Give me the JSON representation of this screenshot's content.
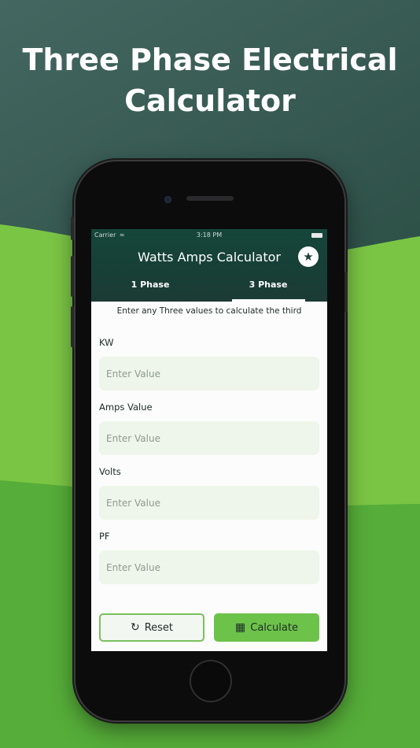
{
  "headline": {
    "line1": "Three Phase Electrical",
    "line2": "Calculator"
  },
  "status_bar": {
    "carrier": "Carrier",
    "wifi": "wifi-icon",
    "time": "3:18 PM",
    "battery": "battery-icon"
  },
  "app_bar": {
    "title": "Watts Amps Calculator",
    "favorite_icon": "star-icon"
  },
  "tabs": [
    {
      "label": "1 Phase",
      "selected": false
    },
    {
      "label": "3 Phase",
      "selected": true
    }
  ],
  "form": {
    "hint": "Enter any Three values to calculate the third",
    "fields": [
      {
        "label": "KW",
        "placeholder": "Enter Value",
        "value": ""
      },
      {
        "label": "Amps Value",
        "placeholder": "Enter Value",
        "value": ""
      },
      {
        "label": "Volts",
        "placeholder": "Enter Value",
        "value": ""
      },
      {
        "label": "PF",
        "placeholder": "Enter Value",
        "value": ""
      }
    ]
  },
  "buttons": {
    "reset": {
      "label": "Reset",
      "icon": "refresh-icon"
    },
    "calculate": {
      "label": "Calculate",
      "icon": "calculator-icon"
    }
  },
  "colors": {
    "accent": "#6dc24a",
    "dark_green": "#173f36",
    "field_bg": "#eef5ea"
  }
}
